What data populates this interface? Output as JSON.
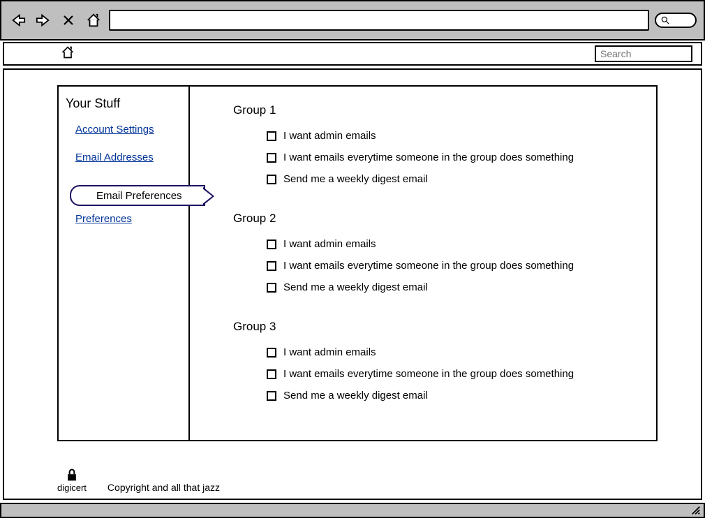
{
  "toolbar": {
    "url_value": ""
  },
  "topbar": {
    "search_placeholder": "Search"
  },
  "sidebar": {
    "title": "Your Stuff",
    "links": {
      "account": "Account Settings",
      "email_addresses": "Email Addresses",
      "email_preferences": "Email Preferences",
      "preferences": "Preferences"
    }
  },
  "groups": [
    {
      "title": "Group 1",
      "options": [
        "I want admin emails",
        "I want emails everytime someone in the group does something",
        "Send me a weekly digest email"
      ]
    },
    {
      "title": "Group 2",
      "options": [
        "I want admin emails",
        "I want emails everytime someone in the group does something",
        "Send me a weekly digest email"
      ]
    },
    {
      "title": "Group 3",
      "options": [
        "I want admin emails",
        "I want emails everytime someone in the group does something",
        "Send me a weekly digest email"
      ]
    }
  ],
  "footer": {
    "cert_label": "digicert",
    "copyright": "Copyright and all that jazz"
  }
}
